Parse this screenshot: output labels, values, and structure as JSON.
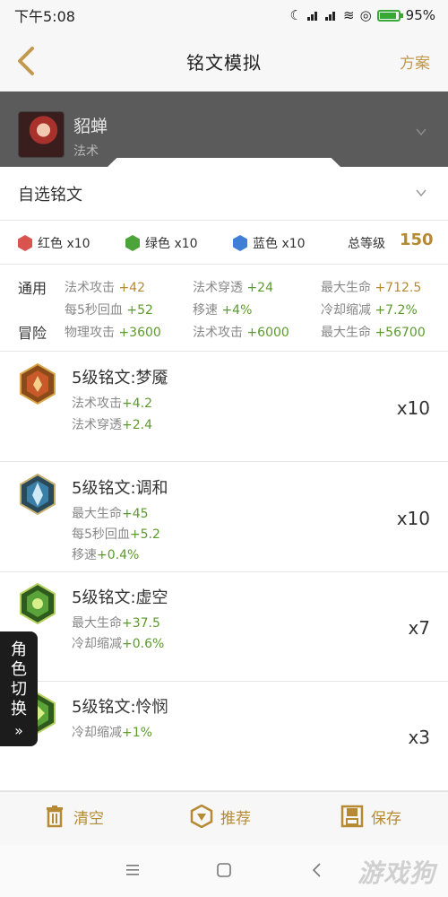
{
  "status": {
    "time": "下午5:08",
    "battery": "95%"
  },
  "nav": {
    "title": "铭文模拟",
    "plan": "方案"
  },
  "hero": {
    "name": "貂蝉",
    "role": "法术"
  },
  "selector": {
    "label": "自选铭文"
  },
  "colors": {
    "red": {
      "label": "红色 x10",
      "hex": "#d9534f"
    },
    "green": {
      "label": "绿色 x10",
      "hex": "#4ca33a"
    },
    "blue": {
      "label": "蓝色 x10",
      "hex": "#3f7fd6"
    },
    "total_label": "总等级",
    "total_value": "150"
  },
  "stats": {
    "general_label": "通用",
    "adventure_label": "冒险",
    "general": [
      {
        "name": "法术攻击",
        "value": "+42"
      },
      {
        "name": "法术穿透",
        "value": "+24"
      },
      {
        "name": "最大生命",
        "value": "+712.5"
      },
      {
        "name": "每5秒回血",
        "value": "+52"
      },
      {
        "name": "移速",
        "value": "+4%"
      },
      {
        "name": "冷却缩减",
        "value": "+7.2%"
      }
    ],
    "adventure": [
      {
        "name": "物理攻击",
        "value": "+3600"
      },
      {
        "name": "法术攻击",
        "value": "+6000"
      },
      {
        "name": "最大生命",
        "value": "+56700"
      }
    ]
  },
  "runes": [
    {
      "title": "5级铭文:梦魇",
      "count": "x10",
      "color": "#c85a2a",
      "lines": [
        {
          "name": "法术攻击",
          "value": "+4.2"
        },
        {
          "name": "法术穿透",
          "value": "+2.4"
        }
      ]
    },
    {
      "title": "5级铭文:调和",
      "count": "x10",
      "color": "#3b7fa8",
      "lines": [
        {
          "name": "最大生命",
          "value": "+45"
        },
        {
          "name": "每5秒回血",
          "value": "+5.2"
        },
        {
          "name": "移速",
          "value": "+0.4%"
        }
      ]
    },
    {
      "title": "5级铭文:虚空",
      "count": "x7",
      "color": "#5aa23a",
      "lines": [
        {
          "name": "最大生命",
          "value": "+37.5"
        },
        {
          "name": "冷却缩减",
          "value": "+0.6%"
        }
      ]
    },
    {
      "title": "5级铭文:怜悯",
      "count": "x3",
      "color": "#5aa23a",
      "lines": [
        {
          "name": "冷却缩减",
          "value": "+1%"
        }
      ]
    }
  ],
  "side_tab": {
    "line1": "角",
    "line2": "色",
    "line3": "切",
    "line4": "换",
    "arrows": "»"
  },
  "bottom": {
    "clear": "清空",
    "recommend": "推荐",
    "save": "保存"
  },
  "watermark": "游戏狗",
  "theme": {
    "accent": "#b58a33",
    "green_value": "#5d9a2e"
  }
}
